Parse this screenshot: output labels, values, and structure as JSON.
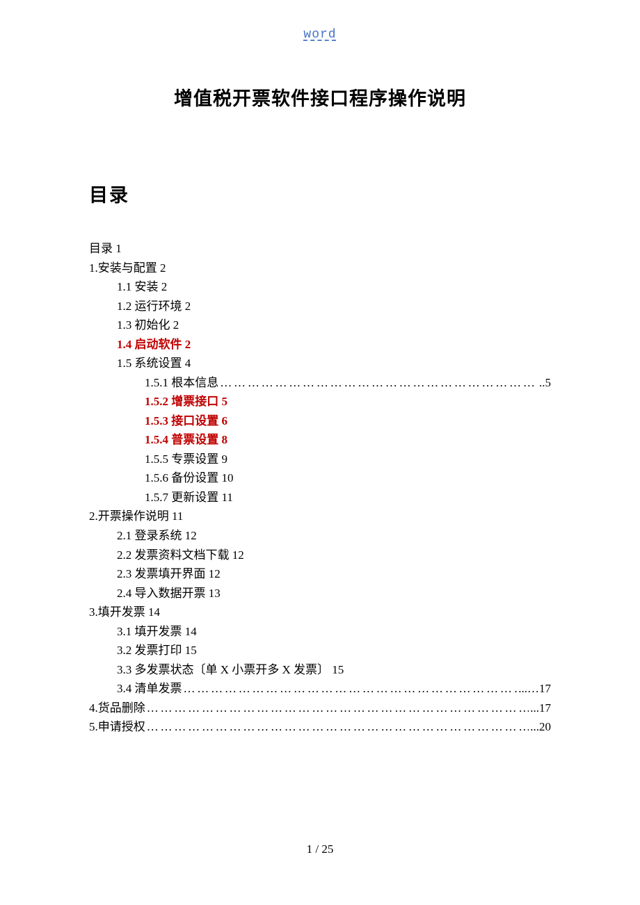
{
  "header_link": "word",
  "main_title": "增值税开票软件接口程序操作说明",
  "toc_heading": "目录",
  "footer": "1  / 25",
  "toc": [
    {
      "lvl": 0,
      "text": "目录 1",
      "red": false,
      "dotted": false,
      "page": ""
    },
    {
      "lvl": 0,
      "text": "1.安装与配置 2",
      "red": false,
      "dotted": false,
      "page": ""
    },
    {
      "lvl": 1,
      "text": "1.1 安装 2",
      "red": false,
      "dotted": false,
      "page": ""
    },
    {
      "lvl": 1,
      "text": "1.2 运行环境 2",
      "red": false,
      "dotted": false,
      "page": ""
    },
    {
      "lvl": 1,
      "text": "1.3 初始化 2",
      "red": false,
      "dotted": false,
      "page": ""
    },
    {
      "lvl": 1,
      "text": "1.4 启动软件 2",
      "red": true,
      "dotted": false,
      "page": ""
    },
    {
      "lvl": 1,
      "text": "1.5 系统设置 4",
      "red": false,
      "dotted": false,
      "page": ""
    },
    {
      "lvl": 2,
      "text": "1.5.1 根本信息",
      "red": false,
      "dotted": true,
      "page": "..5"
    },
    {
      "lvl": 2,
      "text": "1.5.2 增票接口 5",
      "red": true,
      "dotted": false,
      "page": ""
    },
    {
      "lvl": 2,
      "text": "1.5.3 接口设置 6",
      "red": true,
      "dotted": false,
      "page": ""
    },
    {
      "lvl": 2,
      "text": "1.5.4 普票设置 8",
      "red": true,
      "dotted": false,
      "page": ""
    },
    {
      "lvl": 2,
      "text": "1.5.5 专票设置 9",
      "red": false,
      "dotted": false,
      "page": ""
    },
    {
      "lvl": 2,
      "text": "1.5.6 备份设置 10",
      "red": false,
      "dotted": false,
      "page": ""
    },
    {
      "lvl": 2,
      "text": "1.5.7 更新设置 11",
      "red": false,
      "dotted": false,
      "page": ""
    },
    {
      "lvl": 0,
      "text": "2.开票操作说明 11",
      "red": false,
      "dotted": false,
      "page": ""
    },
    {
      "lvl": 1,
      "text": "2.1 登录系统 12",
      "red": false,
      "dotted": false,
      "page": ""
    },
    {
      "lvl": 1,
      "text": "2.2 发票资料文档下载 12",
      "red": false,
      "dotted": false,
      "page": ""
    },
    {
      "lvl": 1,
      "text": "2.3 发票填开界面 12",
      "red": false,
      "dotted": false,
      "page": ""
    },
    {
      "lvl": 1,
      "text": "2.4 导入数据开票 13",
      "red": false,
      "dotted": false,
      "page": ""
    },
    {
      "lvl": 0,
      "text": "3.填开发票 14",
      "red": false,
      "dotted": false,
      "page": ""
    },
    {
      "lvl": 1,
      "text": "3.1 填开发票 14",
      "red": false,
      "dotted": false,
      "page": ""
    },
    {
      "lvl": 1,
      "text": "3.2 发票打印 15",
      "red": false,
      "dotted": false,
      "page": ""
    },
    {
      "lvl": 1,
      "text": "3.3 多发票状态〔单 X 小票开多 X 发票〕  15",
      "red": false,
      "dotted": false,
      "page": ""
    },
    {
      "lvl": 1,
      "text": "3.4  清单发票",
      "red": false,
      "dotted": true,
      "page": "...…17"
    },
    {
      "lvl": 0,
      "text": "4.货品删除",
      "red": false,
      "dotted": true,
      "page": "...17"
    },
    {
      "lvl": 0,
      "text": "5.申请授权",
      "red": false,
      "dotted": true,
      "page": "...20"
    }
  ]
}
